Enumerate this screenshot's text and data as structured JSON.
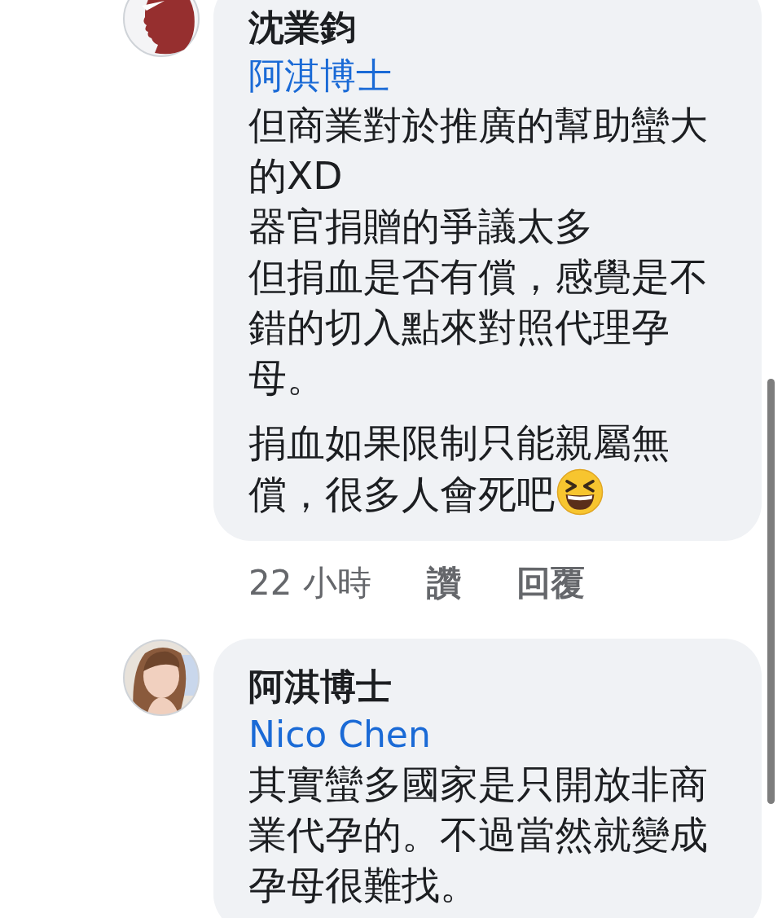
{
  "comments": [
    {
      "avatar": {
        "kind": "silhouette"
      },
      "author": "沈業鈞",
      "mention": "阿淇博士",
      "paragraphs": [
        {
          "kind": "text",
          "lines": [
            "但商業對於推廣的幫助蠻大的XD",
            "器官捐贈的爭議太多",
            "但捐血是否有償，感覺是不錯的切入點來對照代理孕母。"
          ]
        },
        {
          "kind": "text-with-emoji",
          "lines": [
            "捐血如果限制只能親屬無償，很多人會死吧"
          ]
        }
      ],
      "time": "22 小時",
      "actions": [
        "讚",
        "回覆"
      ]
    },
    {
      "avatar": {
        "kind": "picture"
      },
      "author": "阿淇博士",
      "mention": "Nico Chen",
      "paragraphs": [
        {
          "kind": "text",
          "lines": [
            "其實蠻多國家是只開放非商業代孕的。不過當然就變成孕母很難找。"
          ]
        }
      ]
    }
  ]
}
